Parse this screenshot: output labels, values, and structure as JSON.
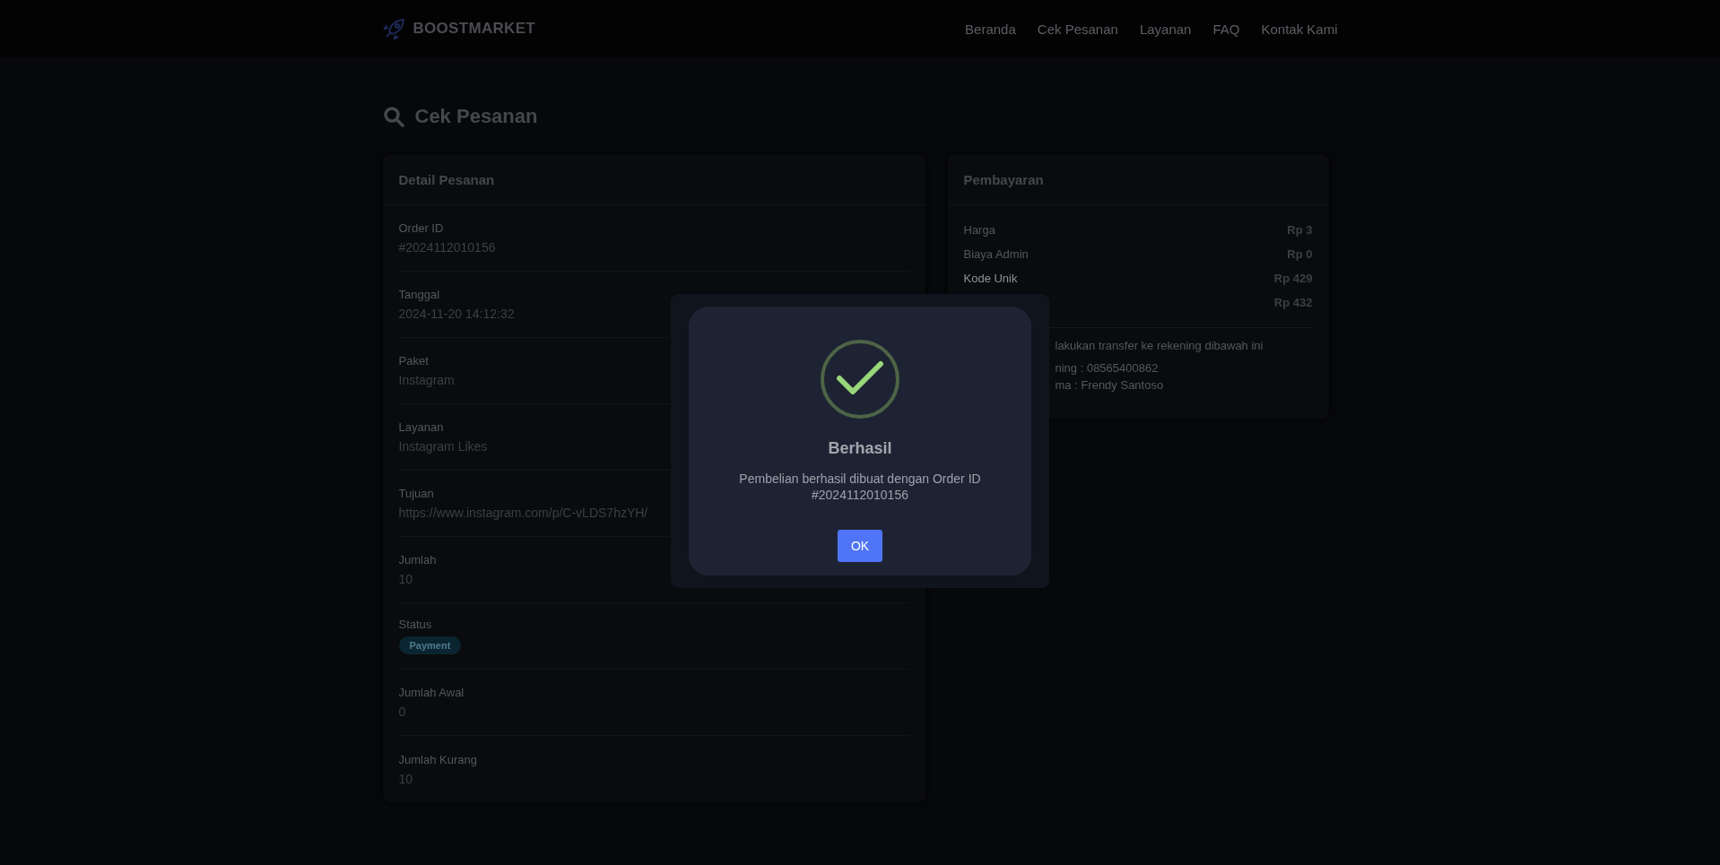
{
  "header": {
    "brand": "BOOSTMARKET",
    "nav": [
      "Beranda",
      "Cek Pesanan",
      "Layanan",
      "FAQ",
      "Kontak Kami"
    ]
  },
  "page_title": "Cek Pesanan",
  "order_details": {
    "title": "Detail Pesanan",
    "fields": [
      {
        "label": "Order ID",
        "value": "#2024112010156",
        "kind": "text"
      },
      {
        "label": "Tanggal",
        "value": "2024-11-20 14:12:32",
        "kind": "text"
      },
      {
        "label": "Paket",
        "value": "Instagram",
        "kind": "text"
      },
      {
        "label": "Layanan",
        "value": "Instagram Likes",
        "kind": "text"
      },
      {
        "label": "Tujuan",
        "value": "https://www.instagram.com/p/C-vLDS7hzYH/",
        "kind": "text"
      },
      {
        "label": "Jumlah",
        "value": "10",
        "kind": "text"
      },
      {
        "label": "Status",
        "value": "Payment",
        "kind": "badge"
      },
      {
        "label": "Jumlah Awal",
        "value": "0",
        "kind": "text"
      },
      {
        "label": "Jumlah Kurang",
        "value": "10",
        "kind": "text"
      }
    ]
  },
  "payment": {
    "title": "Pembayaran",
    "lines": [
      {
        "label": "Harga",
        "amount": "Rp 3"
      },
      {
        "label": "Biaya Admin",
        "amount": "Rp 0"
      },
      {
        "label": "Kode Unik",
        "amount": "Rp 429"
      },
      {
        "amount": "Rp 432"
      }
    ],
    "instructions": [
      "lakukan transfer ke rekening dibawah ini",
      "ning : 08565400862",
      "ma : Frendy Santoso"
    ]
  },
  "dialog": {
    "title": "Berhasil",
    "message": "Pembelian berhasil dibuat dengan Order ID #2024112010156",
    "button": "OK"
  }
}
